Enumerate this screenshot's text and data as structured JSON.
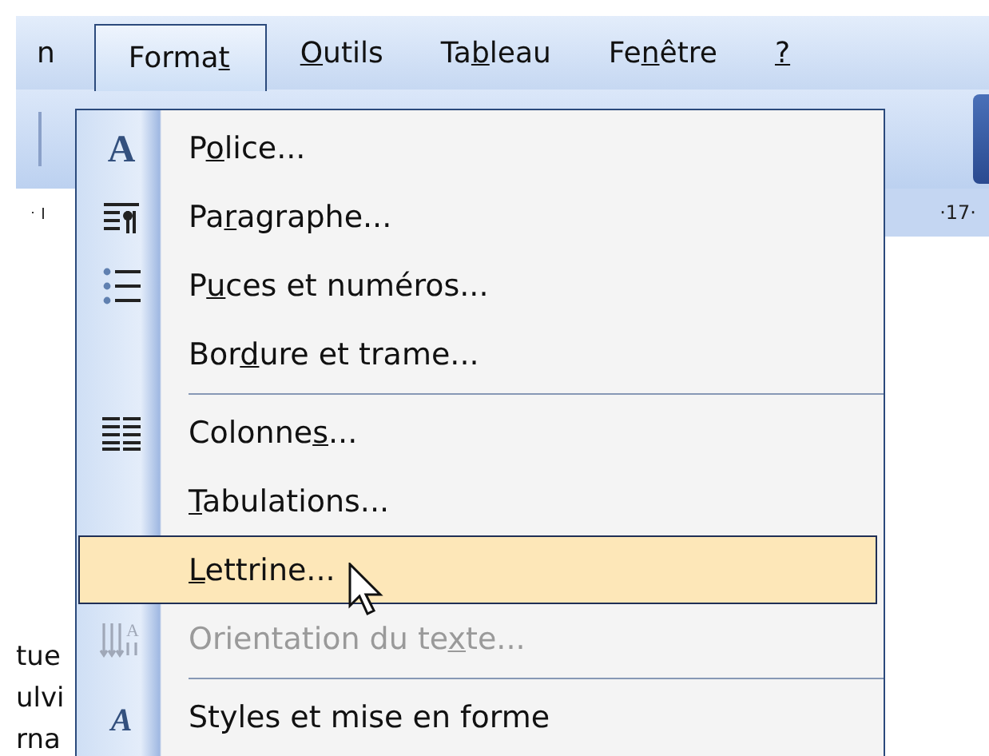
{
  "menubar": [
    {
      "pre": "n",
      "selected": false
    },
    {
      "pre": "Forma",
      "key": "t",
      "selected": true
    },
    {
      "key": "O",
      "post": "utils",
      "selected": false
    },
    {
      "pre": "Ta",
      "key": "b",
      "post": "leau",
      "selected": false
    },
    {
      "pre": "Fe",
      "key": "n",
      "post": "être",
      "selected": false
    },
    {
      "key": "?",
      "selected": false
    }
  ],
  "ruler": {
    "right_label": "·17·"
  },
  "document": {
    "fragments": [
      "tue",
      "ulvi",
      "rna"
    ]
  },
  "menu": [
    {
      "kind": "item",
      "icon_glyph": "A",
      "pre": "P",
      "key": "o",
      "post": "lice...",
      "disabled": false,
      "selected": false
    },
    {
      "kind": "item",
      "pre": "Pa",
      "key": "r",
      "post": "agraphe...",
      "disabled": false,
      "selected": false
    },
    {
      "kind": "item",
      "pre": "P",
      "key": "u",
      "post": "ces et numéros...",
      "disabled": false,
      "selected": false
    },
    {
      "kind": "item",
      "pre": "Bor",
      "key": "d",
      "post": "ure et trame...",
      "disabled": false,
      "selected": false
    },
    {
      "kind": "separator"
    },
    {
      "kind": "item",
      "pre": "Colonne",
      "key": "s",
      "post": "...",
      "disabled": false,
      "selected": false
    },
    {
      "kind": "item",
      "key": "T",
      "post": "abulations...",
      "disabled": false,
      "selected": false
    },
    {
      "kind": "item",
      "key": "L",
      "post": "ettrine...",
      "disabled": false,
      "selected": true
    },
    {
      "kind": "item",
      "icon_glyph": "A",
      "pre": "Orientation du te",
      "key": "x",
      "post": "te...",
      "disabled": true,
      "selected": false
    },
    {
      "kind": "separator"
    },
    {
      "kind": "item",
      "icon_glyph": "A",
      "pre": "Styles et mise en forme",
      "disabled": false,
      "selected": false
    }
  ]
}
